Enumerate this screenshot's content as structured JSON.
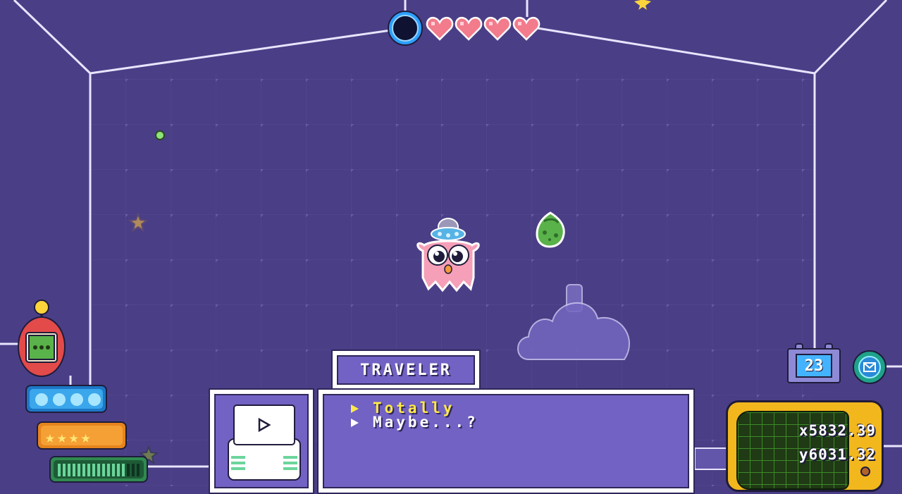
{
  "hud": {
    "health": {
      "hearts_filled": 4,
      "hearts_total": 4
    },
    "blue_meter": {
      "pips_filled": 4
    },
    "star_meter": {
      "stars_filled": 4
    },
    "energy_gauge": {
      "level": 0.82
    }
  },
  "calendar": {
    "day": "23"
  },
  "dialog": {
    "speaker": "TRAVELER",
    "choices": [
      {
        "label": "Totally",
        "selected": true
      },
      {
        "label": "Maybe...?",
        "selected": false
      }
    ]
  },
  "position": {
    "x": "x5832.39",
    "y": "y6031.32"
  },
  "colors": {
    "background": "#4a3f86",
    "dialog_panel": "#7262c4",
    "selected_choice": "#ffe94a",
    "radar_frame": "#f2b71d",
    "heart": "#f27b8c"
  },
  "icons": {
    "device": "tamagotchi-icon",
    "portrait": "printer-icon",
    "calendar": "calendar-icon",
    "mail": "envelope-icon"
  }
}
